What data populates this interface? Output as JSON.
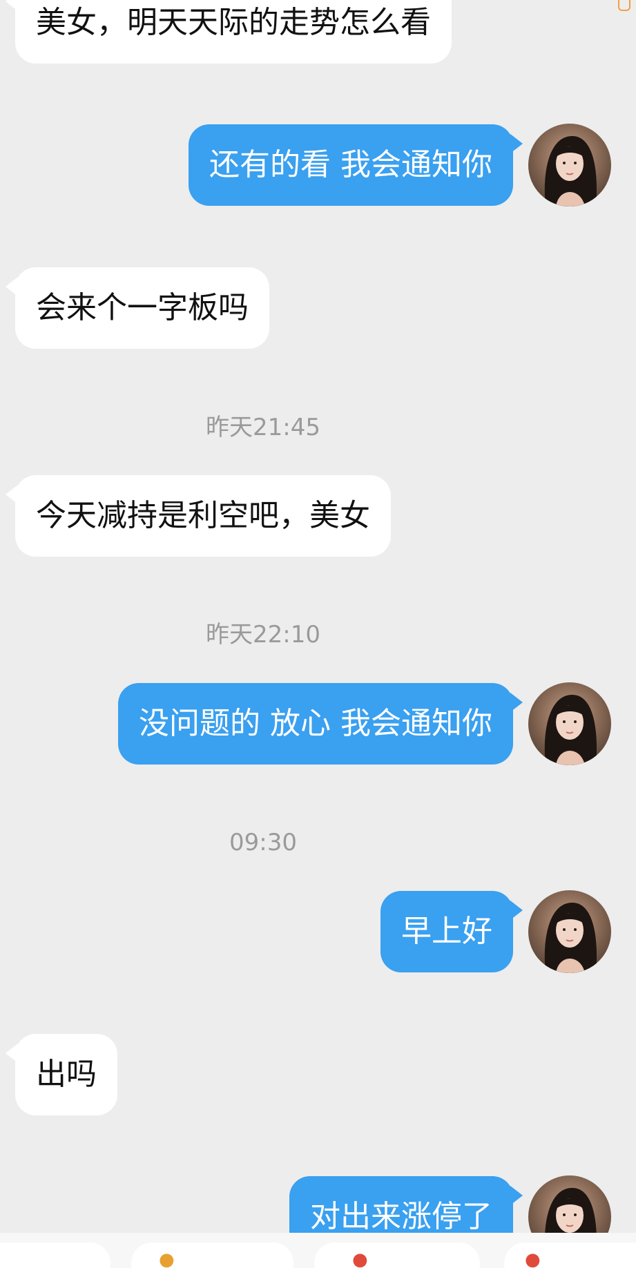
{
  "messages": [
    {
      "side": "left",
      "text": "美女，明天天际的走势怎么看"
    },
    {
      "side": "right",
      "text": "还有的看 我会通知你"
    },
    {
      "side": "left",
      "text": "会来个一字板吗"
    },
    {
      "side": "left",
      "text": "今天减持是利空吧，美女"
    },
    {
      "side": "right",
      "text": "没问题的  放心  我会通知你"
    },
    {
      "side": "right",
      "text": "早上好"
    },
    {
      "side": "left",
      "text": "出吗"
    },
    {
      "side": "right",
      "text": "对出来涨停了"
    }
  ],
  "timestamps": [
    "昨天21:45",
    "昨天22:10",
    "09:30"
  ],
  "colors": {
    "background": "#ededed",
    "right_bubble": "#3aa0f0",
    "left_bubble": "#ffffff",
    "timestamp_text": "#9a9a9a"
  },
  "icons": [
    "avatar-icon",
    "top-indicator-icon",
    "quick-reply-icon"
  ]
}
